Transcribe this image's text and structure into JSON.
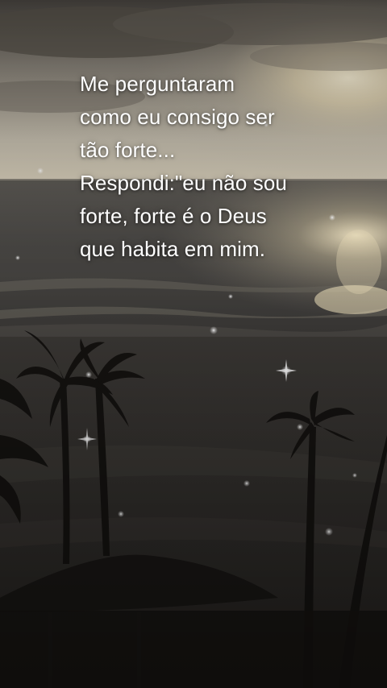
{
  "quote": {
    "lines": [
      "Me perguntaram",
      "como eu consigo ser",
      "tão forte...",
      "Respondi:\"eu não sou",
      "forte, forte é o Deus",
      "que habita em mim."
    ]
  },
  "colors": {
    "text": "#ffffff",
    "sky_top": "#6f6a62",
    "sky_glow": "#fff0c8",
    "sea": "#3f3e3c",
    "sand": "#2b2826",
    "silhouette": "#151311"
  }
}
